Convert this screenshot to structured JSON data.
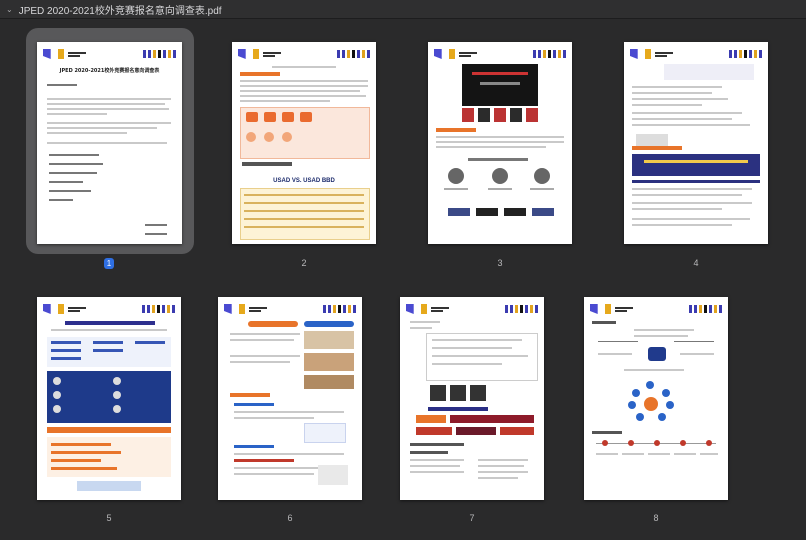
{
  "window": {
    "title": "JPED 2020-2021校外竞赛报名意向调查表.pdf"
  },
  "selected_page": "1",
  "pages": [
    {
      "number": "1",
      "heading": "JPED 2020-2021校外竞赛报名意向调查表"
    },
    {
      "number": "2",
      "heading": "USAD VS. USAD BBD"
    },
    {
      "number": "3"
    },
    {
      "number": "4"
    },
    {
      "number": "5"
    },
    {
      "number": "6"
    },
    {
      "number": "7"
    },
    {
      "number": "8"
    }
  ]
}
